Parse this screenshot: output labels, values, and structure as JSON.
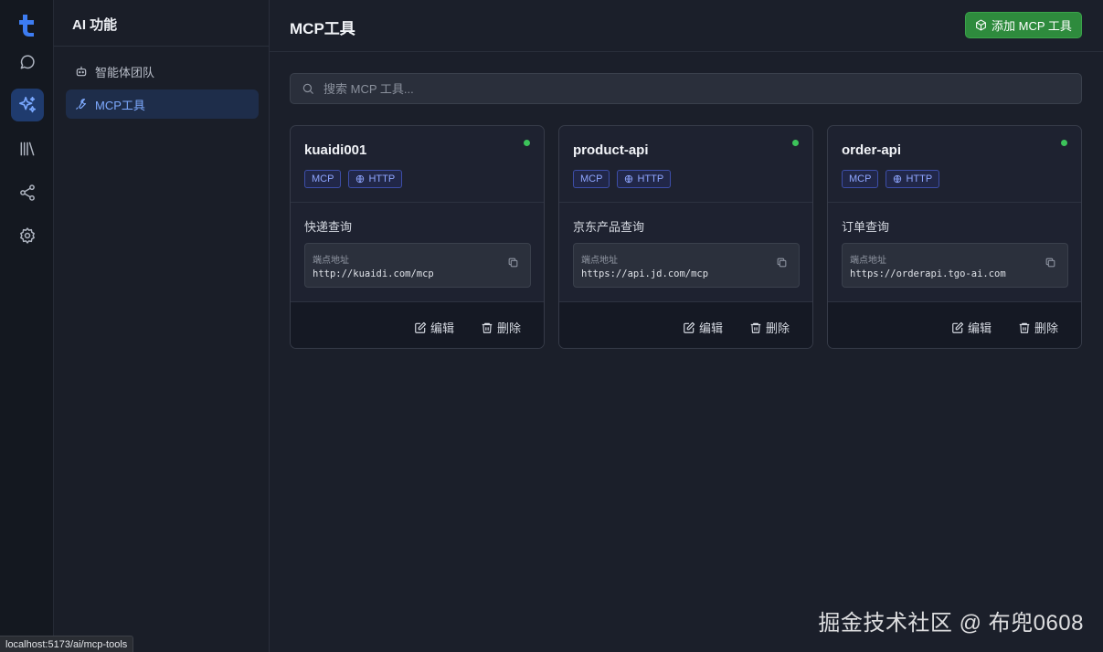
{
  "rail": {
    "items": [
      {
        "icon": "chat-icon",
        "active": false
      },
      {
        "icon": "sparkles-icon",
        "active": true
      },
      {
        "icon": "library-icon",
        "active": false
      },
      {
        "icon": "share-icon",
        "active": false
      },
      {
        "icon": "gear-icon",
        "active": false
      }
    ]
  },
  "subnav": {
    "title": "AI 功能",
    "items": [
      {
        "label": "智能体团队",
        "icon": "robot-icon",
        "active": false
      },
      {
        "label": "MCP工具",
        "icon": "wrench-icon",
        "active": true
      }
    ]
  },
  "header": {
    "title": "MCP工具",
    "add_button": "添加 MCP 工具"
  },
  "search": {
    "placeholder": "搜索 MCP 工具..."
  },
  "card_labels": {
    "endpoint_label": "端点地址",
    "edit": "编辑",
    "delete": "删除"
  },
  "cards": [
    {
      "name": "kuaidi001",
      "tags": [
        "MCP",
        "HTTP"
      ],
      "description": "快递查询",
      "endpoint": "http://kuaidi.com/mcp",
      "status": "online"
    },
    {
      "name": "product-api",
      "tags": [
        "MCP",
        "HTTP"
      ],
      "description": "京东产品查询",
      "endpoint": "https://api.jd.com/mcp",
      "status": "online"
    },
    {
      "name": "order-api",
      "tags": [
        "MCP",
        "HTTP"
      ],
      "description": "订单查询",
      "endpoint": "https://orderapi.tgo-ai.com",
      "status": "online"
    }
  ],
  "watermark": "掘金技术社区 @ 布兜0608",
  "statusbar": "localhost:5173/ai/mcp-tools",
  "colors": {
    "accent": "#2e8b3d",
    "active_nav": "#7eaaff",
    "status_online": "#3cc35a"
  }
}
